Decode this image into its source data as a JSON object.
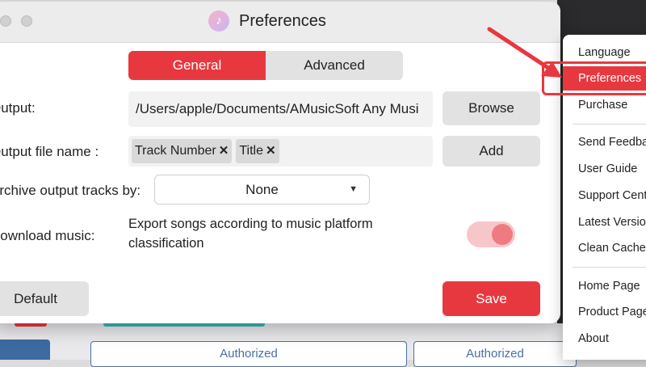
{
  "background_app": {
    "authorized_1": "Authorized",
    "authorized_2": "Authorized"
  },
  "window": {
    "title": "Preferences",
    "tabs": [
      {
        "label": "General",
        "active": true
      },
      {
        "label": "Advanced",
        "active": false
      }
    ],
    "output_label": "Output:",
    "output_path": "/Users/apple/Documents/AMusicSoft Any Musi",
    "browse_label": "Browse",
    "output_file_name_label": "Output file name :",
    "file_name_tags": [
      "Track Number",
      "Title"
    ],
    "add_label": "Add",
    "archive_label": "Archive output tracks by:",
    "archive_value": "None",
    "download_label": "Download music:",
    "download_desc": "Export songs according to music platform classification",
    "download_toggle_on": true,
    "default_label": "Default",
    "save_label": "Save"
  },
  "menu": {
    "items": [
      "Language",
      "Preferences",
      "Purchase",
      "Send Feedback",
      "User Guide",
      "Support Center",
      "Latest Version",
      "Clean Cache",
      "Home Page",
      "Product Page",
      "About"
    ],
    "highlighted": "Preferences"
  },
  "colors": {
    "accent": "#e8383f",
    "annotation": "#e8383f",
    "toggle_track": "#f7c6c9"
  }
}
